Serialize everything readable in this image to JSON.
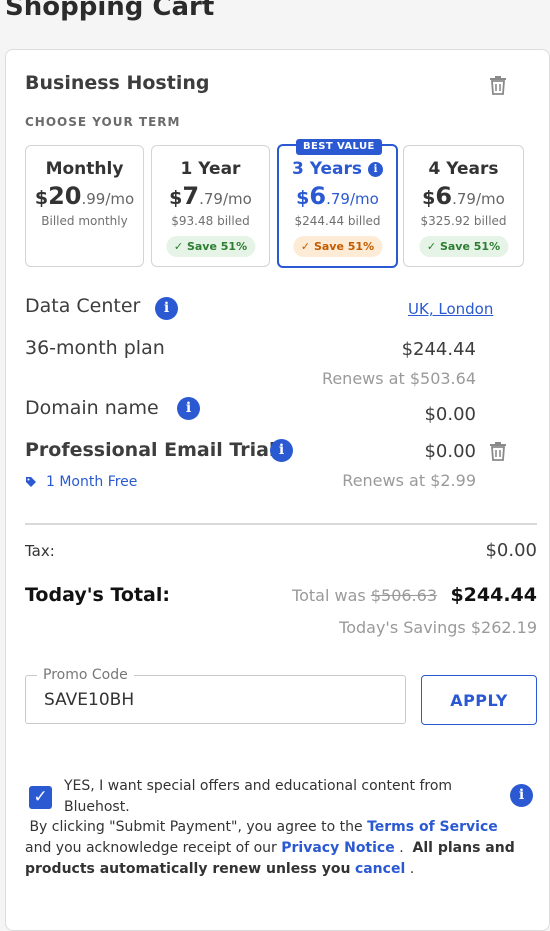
{
  "page": {
    "title": "Shopping Cart"
  },
  "product": {
    "name": "Business Hosting",
    "choose_term_label": "CHOOSE YOUR TERM"
  },
  "terms": [
    {
      "name": "Monthly",
      "currency": "$",
      "whole": "20",
      "fraction": ".99/mo",
      "billed": "Billed monthly",
      "save": ""
    },
    {
      "name": "1 Year",
      "currency": "$",
      "whole": "7",
      "fraction": ".79/mo",
      "billed": "$93.48 billed",
      "save": "Save 51%"
    },
    {
      "name": "3 Years",
      "currency": "$",
      "whole": "6",
      "fraction": ".79/mo",
      "billed": "$244.44 billed",
      "save": "Save 51%",
      "badge": "BEST VALUE",
      "selected": true
    },
    {
      "name": "4 Years",
      "currency": "$",
      "whole": "6",
      "fraction": ".79/mo",
      "billed": "$325.92 billed",
      "save": "Save 51%"
    }
  ],
  "details": {
    "data_center_label": "Data Center",
    "data_center_value": "UK, London",
    "plan_label": "36-month plan",
    "plan_price": "$244.44",
    "plan_renews": "Renews at $503.64",
    "domain_label": "Domain name",
    "domain_price": "$0.00",
    "email_label": "Professional Email Trial",
    "email_price": "$0.00",
    "email_promo": "1 Month Free",
    "email_renews": "Renews at $2.99"
  },
  "totals": {
    "tax_label": "Tax:",
    "tax_value": "$0.00",
    "total_label": "Today's Total:",
    "was_prefix": "Total was",
    "was_value": "$506.63",
    "total_value": "$244.44",
    "savings": "Today's Savings $262.19"
  },
  "promo": {
    "legend": "Promo Code",
    "value": "SAVE10BH",
    "apply_label": "APPLY"
  },
  "consent": {
    "checked": true,
    "text": "YES, I want special offers and educational content from Bluehost.",
    "legal_1": "By clicking \"Submit Payment\", you agree to the",
    "terms_link": "Terms of Service",
    "legal_2": "and you acknowledge receipt of our",
    "privacy_link": "Privacy Notice",
    "legal_3": ".",
    "legal_bold": "All plans and products automatically renew unless you",
    "cancel_link": "cancel",
    "legal_4": "."
  },
  "icons": {
    "info": "info-icon",
    "trash": "trash-icon",
    "tag": "tag-icon",
    "check": "check-icon"
  },
  "colors": {
    "accent": "#2a59d1",
    "save_green_bg": "#e5f4e6",
    "save_orange_bg": "#fdebd5"
  }
}
